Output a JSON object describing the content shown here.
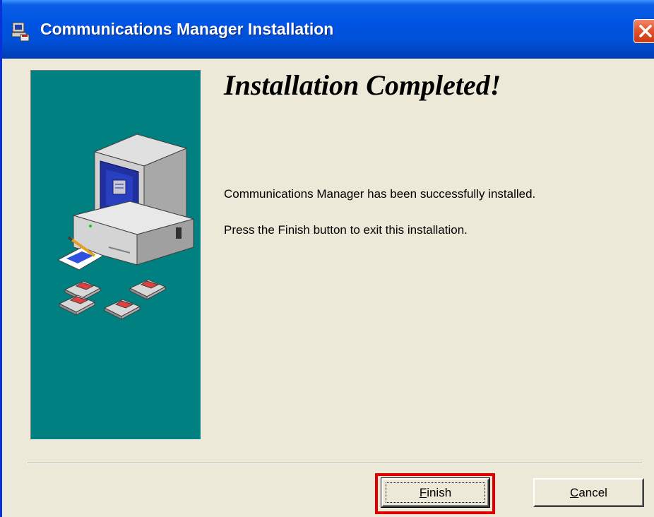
{
  "window": {
    "title": "Communications Manager Installation",
    "titlebar_color": "#0054E3",
    "close_button_color": "#E2542F"
  },
  "side_panel": {
    "background_color": "#008080",
    "illustration": "computer-with-floppy-disks"
  },
  "content": {
    "heading": "Installation Completed!",
    "message_line_1": "Communications Manager has been successfully installed.",
    "message_line_2": "Press the Finish button to exit this installation."
  },
  "buttons": {
    "finish": {
      "mnemonic": "F",
      "rest": "inish",
      "highlighted": true,
      "highlight_color": "#E00000"
    },
    "cancel": {
      "mnemonic": "C",
      "rest": "ancel"
    }
  },
  "icons": {
    "app_icon": "setup-computer-icon",
    "close": "close-x-icon"
  }
}
